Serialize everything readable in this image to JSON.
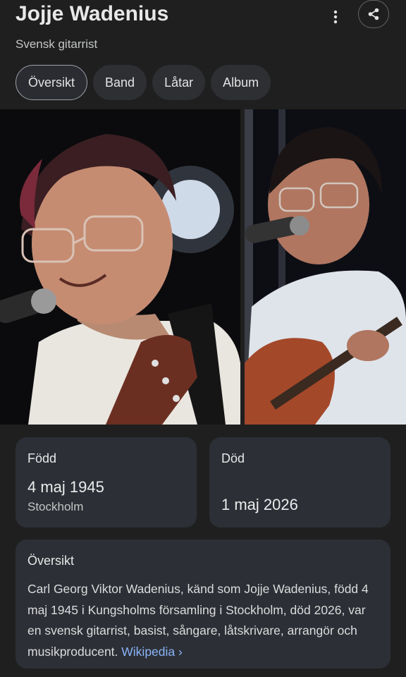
{
  "header": {
    "title": "Jojje Wadenius",
    "subtitle": "Svensk gitarrist"
  },
  "tabs": [
    {
      "label": "Översikt",
      "active": true
    },
    {
      "label": "Band",
      "active": false
    },
    {
      "label": "Låtar",
      "active": false
    },
    {
      "label": "Album",
      "active": false
    }
  ],
  "facts": {
    "born": {
      "label": "Född",
      "date": "4 maj 1945",
      "place": "Stockholm"
    },
    "died": {
      "label": "Död",
      "date": "1 maj 2026"
    }
  },
  "overview": {
    "title": "Översikt",
    "text": "Carl Georg Viktor Wadenius, känd som Jojje Wadenius, född 4 maj 1945 i Kungsholms församling i Stockholm, död 2026, var en svensk gitarrist, basist, sångare, låtskrivare, arrangör och musikproducent.",
    "source_link": "Wikipedia",
    "source_chevron": "›"
  },
  "icons": {
    "menu": "more-vert-icon",
    "share": "share-icon"
  },
  "colors": {
    "background": "#1f1f1f",
    "card": "#2c2f36",
    "link": "#8ab4f8"
  }
}
